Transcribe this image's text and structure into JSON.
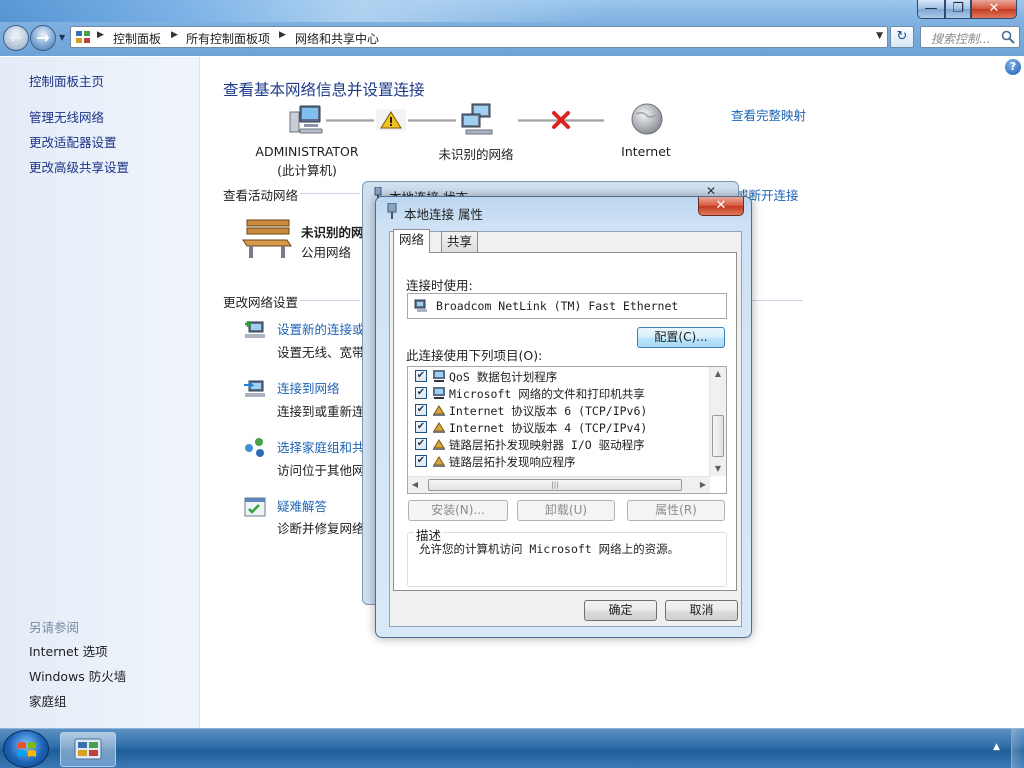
{
  "window": {
    "minimize_glyph": "—",
    "maximize_glyph": "❐",
    "close_glyph": "✕"
  },
  "address": {
    "crumbs": [
      "控制面板",
      "所有控制面板项",
      "网络和共享中心"
    ],
    "search_placeholder": "搜索控制..."
  },
  "left_pane": {
    "home": "控制面板主页",
    "links": [
      "管理无线网络",
      "更改适配器设置",
      "更改高级共享设置"
    ],
    "see_also_title": "另请参阅",
    "see_also": [
      "Internet 选项",
      "Windows 防火墙",
      "家庭组"
    ]
  },
  "main": {
    "title": "查看基本网络信息并设置连接",
    "full_map_link": "查看完整映射",
    "nodes": {
      "computer_line1": "ADMINISTRATOR",
      "computer_line2": "(此计算机)",
      "network": "未识别的网络",
      "internet": "Internet"
    },
    "active_networks_header": "查看活动网络",
    "disconnect_link": "或断开连接",
    "active_network_name": "未识别的网",
    "active_network_type": "公用网络",
    "change_settings_header": "更改网络设置",
    "tasks": [
      {
        "title": "设置新的连接或",
        "desc": "设置无线、宽带"
      },
      {
        "title": "连接到网络",
        "desc": "连接到或重新连"
      },
      {
        "title": "选择家庭组和共",
        "desc": "访问位于其他网"
      },
      {
        "title": "疑难解答",
        "desc": "诊断并修复网络"
      }
    ]
  },
  "status_dialog": {
    "title": "本地连接 状态",
    "close_glyph": "✕"
  },
  "props_dialog": {
    "title": "本地连接 属性",
    "close_glyph": "✕",
    "tabs": [
      "网络",
      "共享"
    ],
    "connect_using_label": "连接时使用:",
    "adapter_name": "Broadcom NetLink (TM) Fast Ethernet",
    "configure_button": "配置(C)...",
    "items_label": "此连接使用下列项目(O):",
    "items": [
      {
        "label": "QoS 数据包计划程序",
        "checked": true,
        "icon": "qos-icon"
      },
      {
        "label": "Microsoft 网络的文件和打印机共享",
        "checked": true,
        "icon": "file-sharing-icon"
      },
      {
        "label": "Internet 协议版本 6 (TCP/IPv6)",
        "checked": true,
        "icon": "protocol-icon"
      },
      {
        "label": "Internet 协议版本 4 (TCP/IPv4)",
        "checked": true,
        "icon": "protocol-icon"
      },
      {
        "label": "链路层拓扑发现映射器 I/O 驱动程序",
        "checked": true,
        "icon": "protocol-icon"
      },
      {
        "label": "链路层拓扑发现响应程序",
        "checked": true,
        "icon": "protocol-icon"
      }
    ],
    "check_glyph": "✔",
    "install_button": "安装(N)...",
    "uninstall_button": "卸载(U)",
    "properties_button": "属性(R)",
    "description_legend": "描述",
    "description_text": "允许您的计算机访问 Microsoft 网络上的资源。",
    "ok_button": "确定",
    "cancel_button": "取消"
  },
  "taskbar": {
    "tray_arrow": "▲"
  }
}
